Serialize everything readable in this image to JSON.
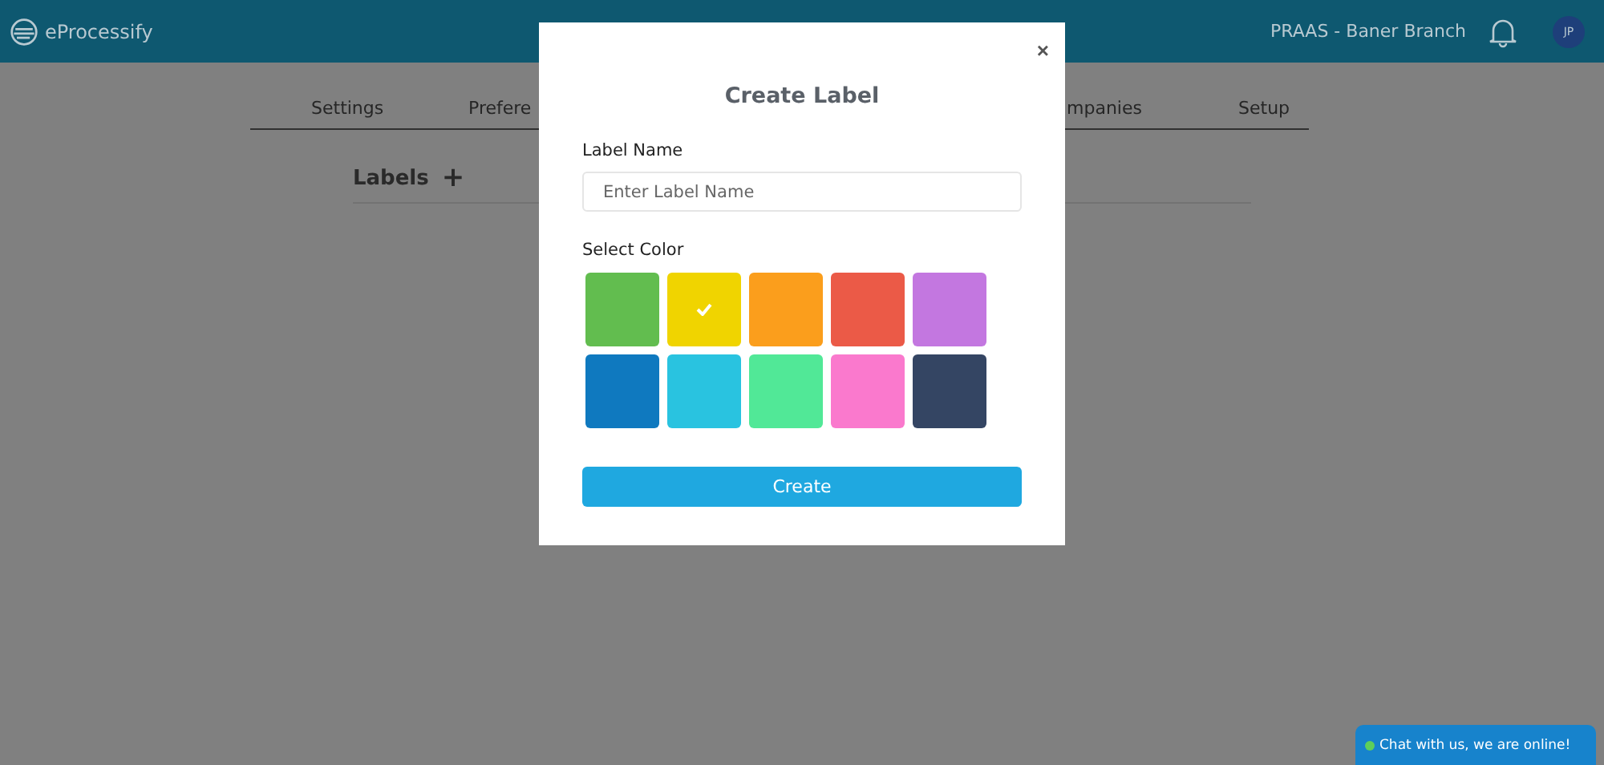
{
  "header": {
    "logo": "eProcessify",
    "branch": "PRAAS - Baner Branch",
    "avatar": "JP"
  },
  "tabs": [
    {
      "label": "Settings"
    },
    {
      "label": "Prefere"
    },
    {
      "label": "mpanies"
    },
    {
      "label": "Setup"
    }
  ],
  "section": {
    "title": "Labels",
    "add": "+"
  },
  "dialog": {
    "title": "Create Label",
    "close": "×",
    "name_label": "Label Name",
    "name_placeholder": "Enter Label Name",
    "color_label": "Select Color",
    "submit": "Create",
    "swatches": [
      {
        "color": "#62bd4f",
        "selected": false
      },
      {
        "color": "#f0d400",
        "selected": true
      },
      {
        "color": "#fb9e1c",
        "selected": false
      },
      {
        "color": "#eb5a47",
        "selected": false
      },
      {
        "color": "#c377e0",
        "selected": false
      },
      {
        "color": "#0f79bf",
        "selected": false
      },
      {
        "color": "#29c3e0",
        "selected": false
      },
      {
        "color": "#51e897",
        "selected": false
      },
      {
        "color": "#fa79cd",
        "selected": false
      },
      {
        "color": "#344563",
        "selected": false
      }
    ]
  },
  "chat": {
    "text": "Chat with us, we are online!",
    "online": true
  }
}
